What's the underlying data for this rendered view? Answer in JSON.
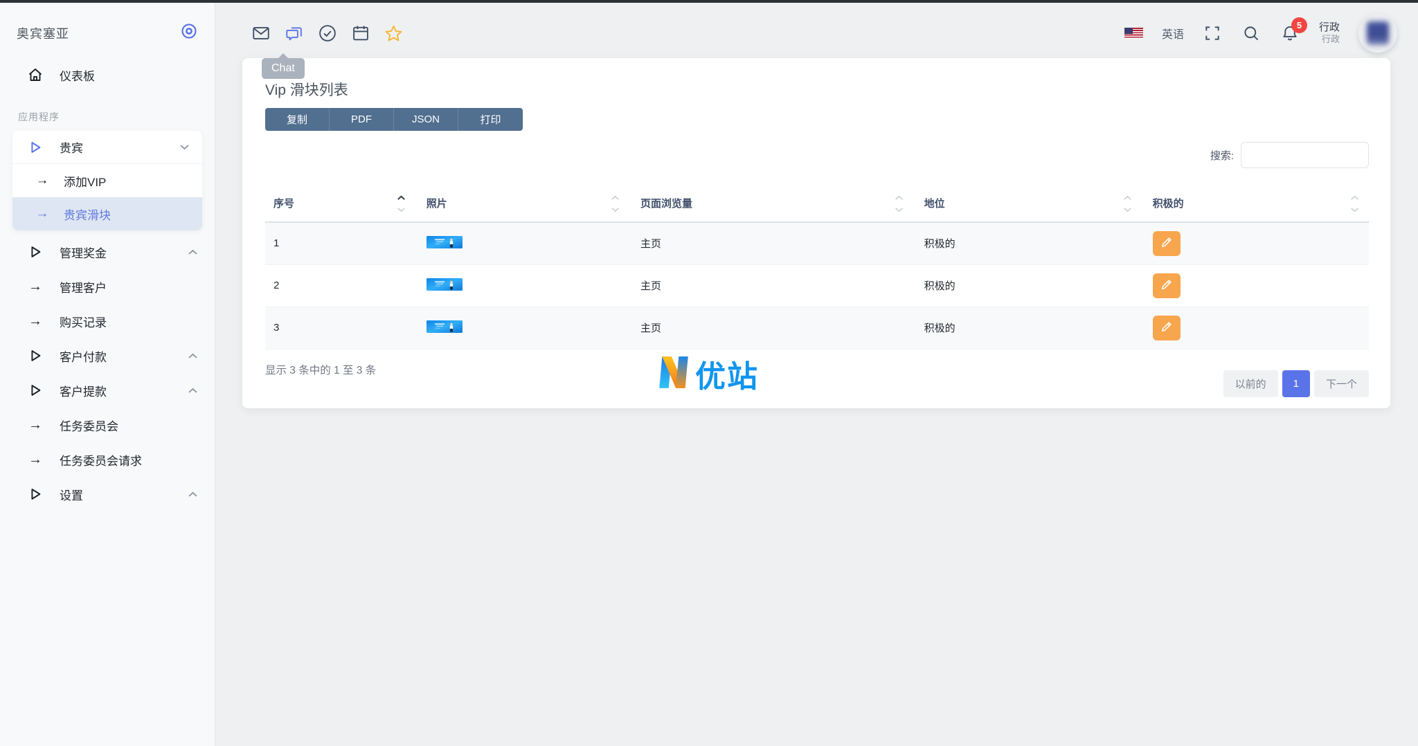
{
  "app": {
    "brand": "奥宾塞亚"
  },
  "sidebar": {
    "dashboard_label": "仪表板",
    "apps_section_label": "应用程序",
    "vip_group_label": "贵宾",
    "vip_children": [
      {
        "label": "添加VIP"
      },
      {
        "label": "贵宾滑块"
      }
    ],
    "items": [
      {
        "label": "管理奖金",
        "type": "group"
      },
      {
        "label": "管理客户",
        "type": "leaf"
      },
      {
        "label": "购买记录",
        "type": "leaf"
      },
      {
        "label": "客户付款",
        "type": "group"
      },
      {
        "label": "客户提款",
        "type": "group"
      },
      {
        "label": "任务委员会",
        "type": "leaf"
      },
      {
        "label": "任务委员会请求",
        "type": "leaf"
      },
      {
        "label": "设置",
        "type": "group"
      }
    ]
  },
  "topbar": {
    "chat_tooltip": "Chat",
    "language_label": "英语",
    "notification_count": "5",
    "user_name": "行政",
    "user_role": "行政"
  },
  "main": {
    "title": "Vip 滑块列表",
    "export_buttons": [
      {
        "label": "复制"
      },
      {
        "label": "PDF"
      },
      {
        "label": "JSON"
      },
      {
        "label": "打印"
      }
    ],
    "search_label": "搜索:",
    "search_value": "",
    "table": {
      "columns": [
        {
          "label": "序号",
          "sorted": "asc"
        },
        {
          "label": "照片",
          "sorted": "none"
        },
        {
          "label": "页面浏览量",
          "sorted": "none"
        },
        {
          "label": "地位",
          "sorted": "none"
        },
        {
          "label": "积极的",
          "sorted": "none"
        }
      ],
      "rows": [
        {
          "serial": "1",
          "page_view": "主页",
          "status": "积极的"
        },
        {
          "serial": "2",
          "page_view": "主页",
          "status": "积极的"
        },
        {
          "serial": "3",
          "page_view": "主页",
          "status": "积极的"
        }
      ]
    },
    "info_text": "显示 3 条中的 1 至 3 条",
    "pagination": {
      "previous": "以前的",
      "current": "1",
      "next": "下一个"
    },
    "watermark_text": "优站"
  },
  "colors": {
    "accent_blue": "#5b73e8",
    "export_button": "#516f8f",
    "edit_orange": "#f7a64d",
    "badge_red": "#f34541",
    "star_orange": "#f8b425",
    "logo_blue": "#1095ef",
    "logo_orange": "#f8a01d",
    "active_item_bg": "#dfe6f3"
  }
}
